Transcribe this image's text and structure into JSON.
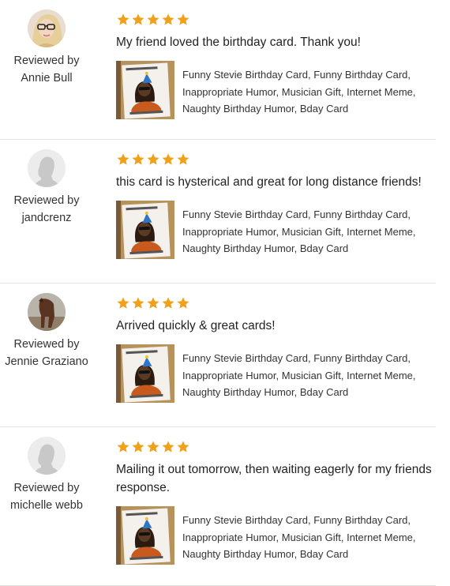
{
  "reviews": [
    {
      "rating": 5,
      "reviewed_by_label": "Reviewed by",
      "reviewer": "Annie Bull",
      "avatar": "photo-woman-glasses",
      "text": "My friend loved the birthday card. Thank you!",
      "product_title": "Funny Stevie Birthday Card, Funny Birthday Card, Inappropriate Humor, Musician Gift, Internet Meme, Naughty Birthday Humor, Bday Card"
    },
    {
      "rating": 5,
      "reviewed_by_label": "Reviewed by",
      "reviewer": "jandcrenz",
      "avatar": "default-silhouette",
      "text": "this card is hysterical and great for long distance friends!",
      "product_title": "Funny Stevie Birthday Card, Funny Birthday Card, Inappropriate Humor, Musician Gift, Internet Meme, Naughty Birthday Humor, Bday Card"
    },
    {
      "rating": 5,
      "reviewed_by_label": "Reviewed by",
      "reviewer": "Jennie Graziano",
      "avatar": "photo-horse",
      "text": "Arrived quickly & great cards!",
      "product_title": "Funny Stevie Birthday Card, Funny Birthday Card, Inappropriate Humor, Musician Gift, Internet Meme, Naughty Birthday Humor, Bday Card"
    },
    {
      "rating": 5,
      "reviewed_by_label": "Reviewed by",
      "reviewer": "michelle webb",
      "avatar": "default-silhouette",
      "text": "Mailing it out tomorrow, then waiting eagerly for my friends response.",
      "product_title": "Funny Stevie Birthday Card, Funny Birthday Card, Inappropriate Humor, Musician Gift, Internet Meme, Naughty Birthday Humor, Bday Card"
    }
  ],
  "colors": {
    "star": "#f1a01a",
    "divider": "#e1e3df",
    "text": "#222222"
  },
  "icons": {
    "star": "star-icon",
    "default_avatar": "person-silhouette-icon"
  }
}
